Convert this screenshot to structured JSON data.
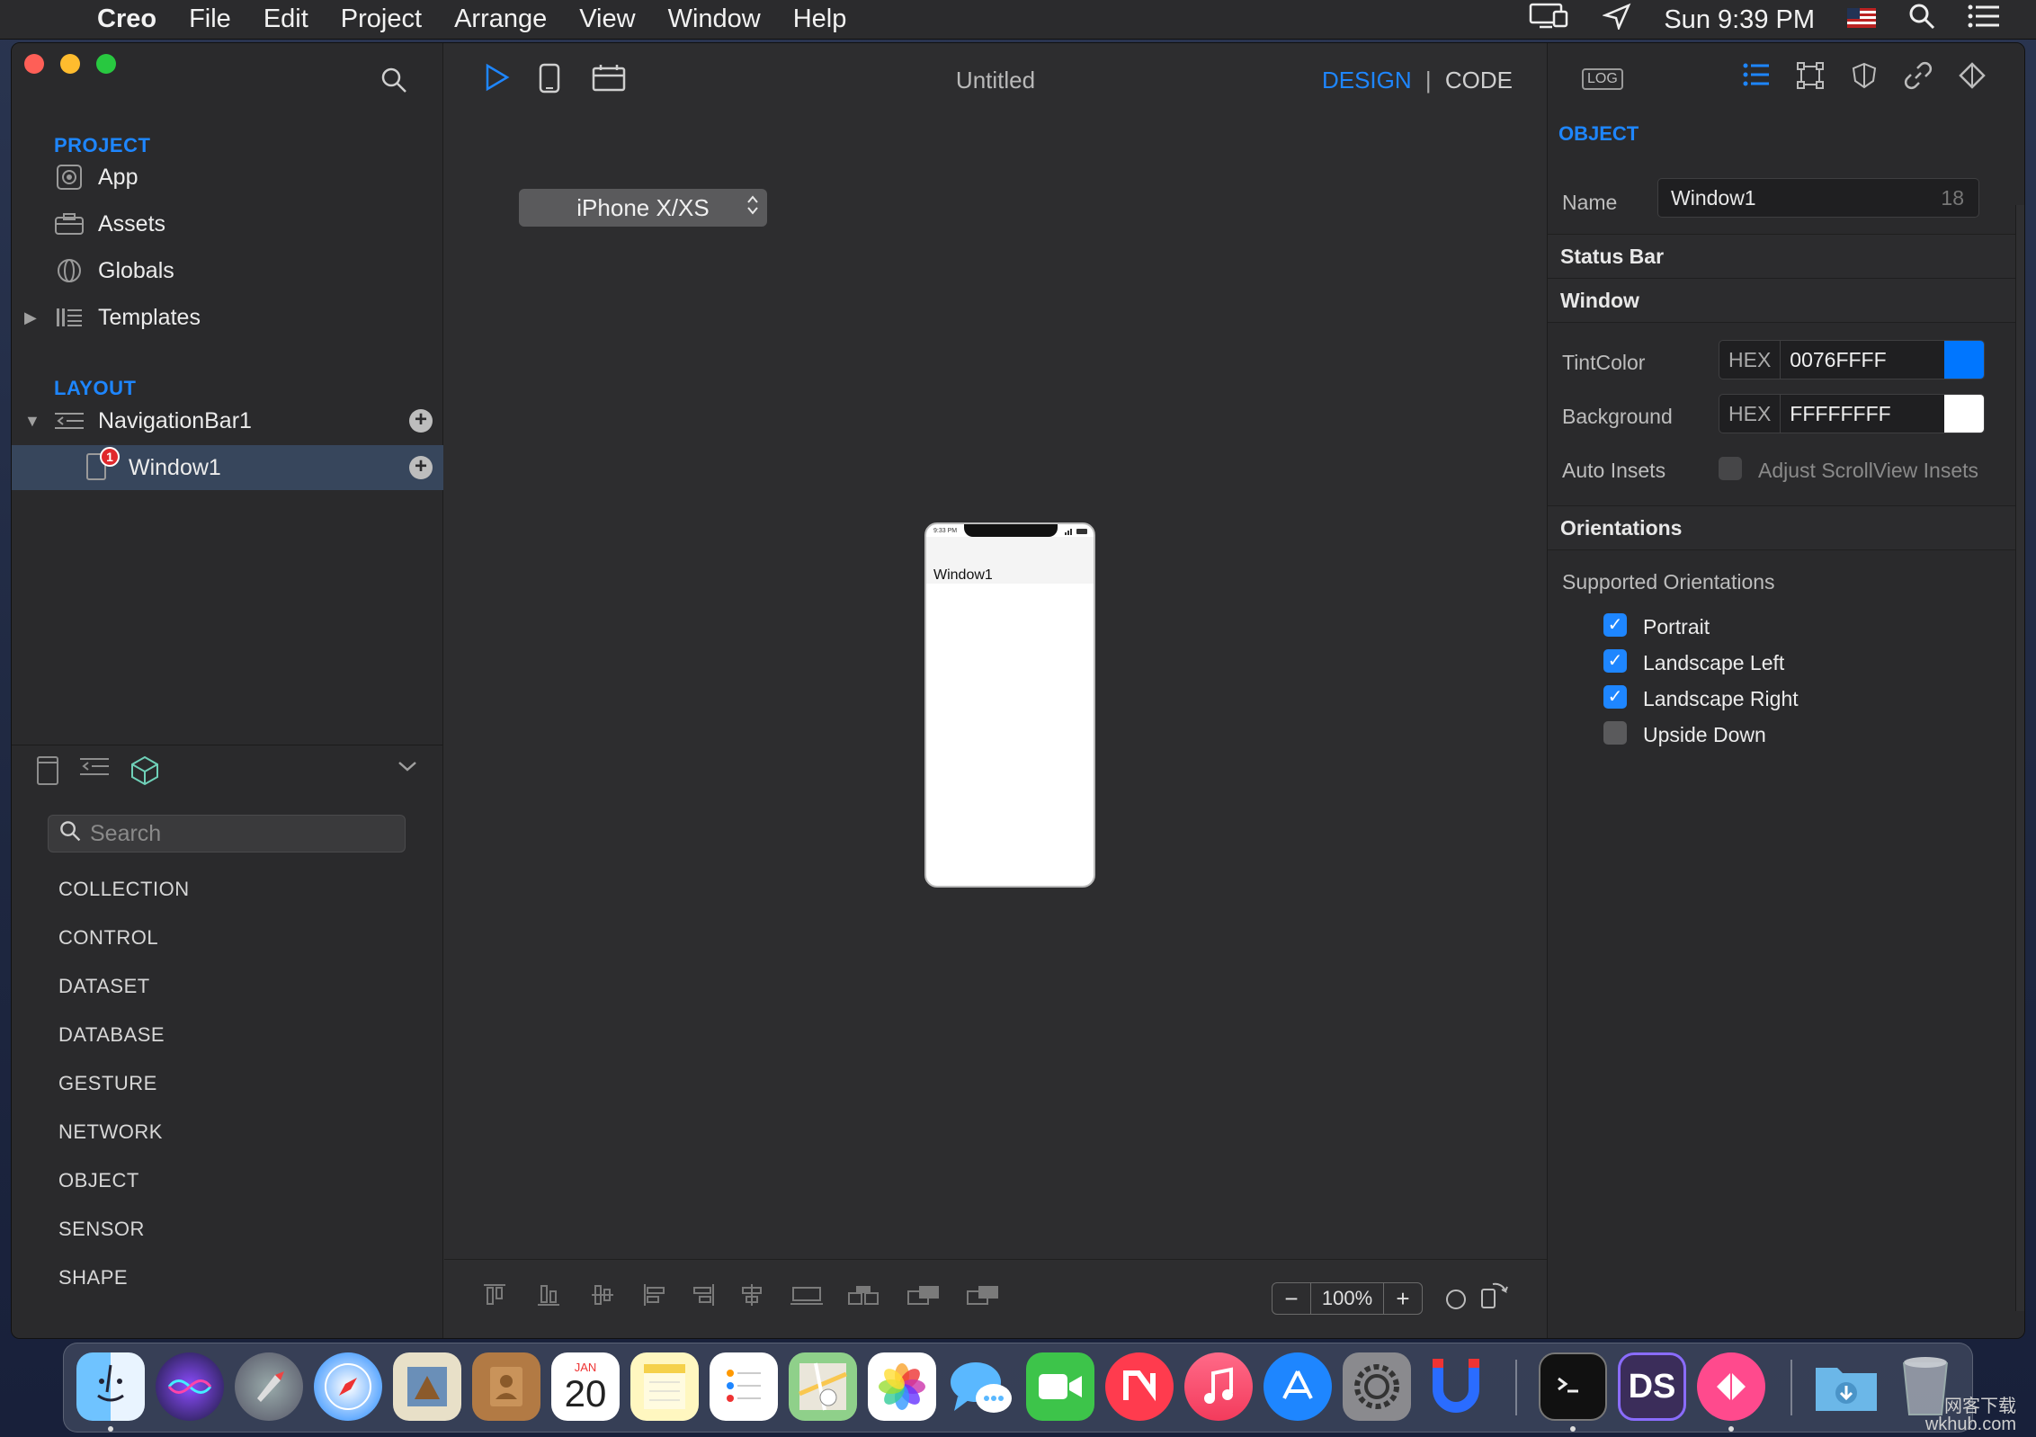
{
  "menubar": {
    "app_name": "Creo",
    "items": [
      "File",
      "Edit",
      "Project",
      "Arrange",
      "View",
      "Window",
      "Help"
    ],
    "clock": "Sun 9:39 PM",
    "icons": [
      "display-icon",
      "location-icon",
      "flag-icon",
      "search-icon",
      "list-icon"
    ]
  },
  "sidebar": {
    "project_title": "PROJECT",
    "project_items": [
      {
        "label": "App",
        "icon": "app-icon"
      },
      {
        "label": "Assets",
        "icon": "assets-icon"
      },
      {
        "label": "Globals",
        "icon": "globe-icon"
      },
      {
        "label": "Templates",
        "icon": "templates-icon"
      }
    ],
    "layout_title": "LAYOUT",
    "layout_items": [
      {
        "label": "NavigationBar1",
        "icon": "navbar-icon"
      },
      {
        "label": "Window1",
        "icon": "window-icon",
        "badge": "1"
      }
    ],
    "search_placeholder": "Search",
    "categories": [
      "COLLECTION",
      "CONTROL",
      "DATASET",
      "DATABASE",
      "GESTURE",
      "NETWORK",
      "OBJECT",
      "SENSOR",
      "SHAPE"
    ]
  },
  "center": {
    "doc_title": "Untitled",
    "mode_design": "DESIGN",
    "mode_separator": "|",
    "mode_code": "CODE",
    "device": "iPhone X/XS",
    "phone_time": "9:33 PM",
    "phone_window_title": "Window1",
    "zoom_minus": "−",
    "zoom_value": "100%",
    "zoom_plus": "+"
  },
  "inspector": {
    "log_label": "LOG",
    "section": "OBJECT",
    "name_label": "Name",
    "name_value": "Window1",
    "name_count": "18",
    "status_bar": "Status Bar",
    "window": "Window",
    "tint_label": "TintColor",
    "hex_label": "HEX",
    "tint_value": "0076FFFF",
    "tint_color": "#0076FF",
    "background_label": "Background",
    "background_value": "FFFFFFFF",
    "background_color": "#FFFFFF",
    "auto_insets_label": "Auto Insets",
    "auto_insets_option": "Adjust ScrollView Insets",
    "orientations": "Orientations",
    "supported_orientations": "Supported Orientations",
    "orientation_options": [
      {
        "label": "Portrait",
        "checked": true
      },
      {
        "label": "Landscape Left",
        "checked": true
      },
      {
        "label": "Landscape Right",
        "checked": true
      },
      {
        "label": "Upside Down",
        "checked": false
      }
    ]
  },
  "dock": {
    "apps": [
      "Finder",
      "Siri",
      "Launchpad",
      "Safari",
      "Mail",
      "Contacts",
      "Calendar",
      "Notes",
      "Reminders",
      "Maps",
      "Photos",
      "Messages",
      "FaceTime",
      "News",
      "Music",
      "App Store",
      "System Preferences",
      "Magnet",
      "Terminal",
      "DS",
      "Kite",
      "Downloads",
      "Trash"
    ],
    "calendar_month": "JAN",
    "calendar_day": "20",
    "ds_label": "DS",
    "watermark_line1": "网客下载",
    "watermark_line2": "wkhub.com"
  },
  "colors": {
    "accent": "#1E86FF",
    "selection": "#37465C"
  }
}
